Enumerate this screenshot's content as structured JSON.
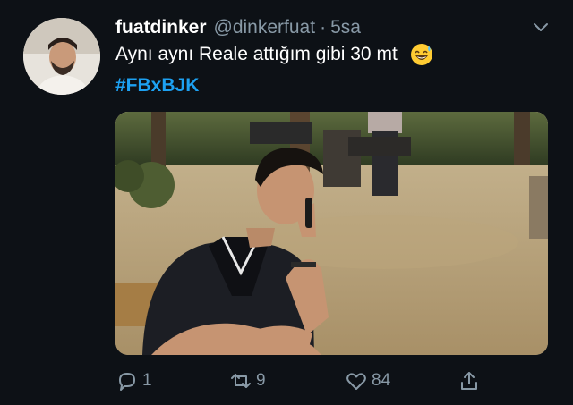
{
  "tweet": {
    "display_name": "fuatdinker",
    "handle": "@dinkerfuat",
    "separator": "·",
    "time": "5sa",
    "text": "Aynı aynı Reale attığım gibi  30 mt",
    "emoji": "grinning-sweat-emoji",
    "hashtag": "#FBxBJK"
  },
  "actions": {
    "reply_count": "1",
    "retweet_count": "9",
    "like_count": "84"
  },
  "colors": {
    "background": "#0d1116",
    "text": "#ffffff",
    "secondary": "#8899a6",
    "link": "#1da1f2"
  }
}
